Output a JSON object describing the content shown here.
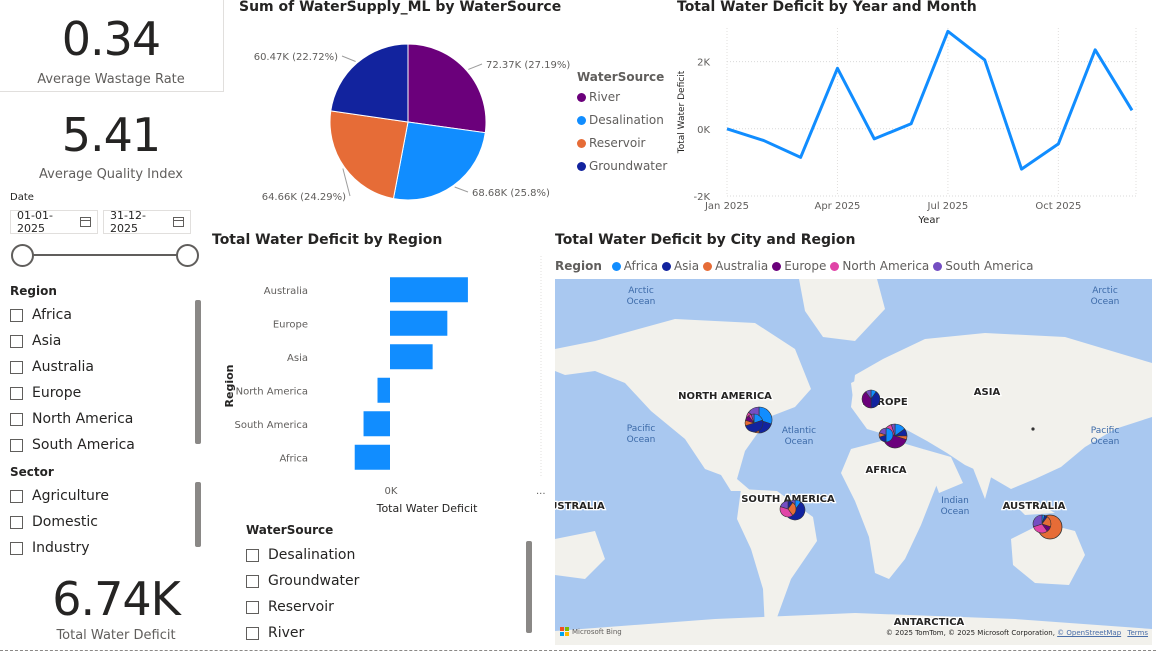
{
  "kpi": {
    "wastage_value": "0.34",
    "wastage_label": "Average Wastage Rate",
    "quality_value": "5.41",
    "quality_label": "Average Quality Index",
    "deficit_value": "6.74K",
    "deficit_label": "Total Water Deficit"
  },
  "date_slicer": {
    "title": "Date",
    "start": "01-01-2025",
    "end": "31-12-2025"
  },
  "region_slicer": {
    "title": "Region",
    "items": [
      "Africa",
      "Asia",
      "Australia",
      "Europe",
      "North America",
      "South America"
    ]
  },
  "sector_slicer": {
    "title": "Sector",
    "items": [
      "Agriculture",
      "Domestic",
      "Industry"
    ]
  },
  "source_slicer": {
    "title": "WaterSource",
    "items": [
      "Desalination",
      "Groundwater",
      "Reservoir",
      "River"
    ]
  },
  "pie": {
    "title": "Sum of WaterSupply_ML by WaterSource",
    "legend_title": "WaterSource",
    "slices": [
      {
        "name": "River",
        "value": 72.37,
        "label": "72.37K (27.19%)",
        "color": "#6b007b"
      },
      {
        "name": "Desalination",
        "value": 68.68,
        "label": "68.68K (25.8%)",
        "color": "#118dff"
      },
      {
        "name": "Reservoir",
        "value": 64.66,
        "label": "64.66K (24.29%)",
        "color": "#e66c37"
      },
      {
        "name": "Groundwater",
        "value": 60.47,
        "label": "60.47K (22.72%)",
        "color": "#12239e"
      }
    ]
  },
  "line": {
    "title": "Total Water Deficit by Year and Month",
    "ylabel": "Total Water Deficit",
    "xlabel": "Year",
    "yticks": [
      "2K",
      "0K",
      "-2K"
    ],
    "xticks": [
      "Jan 2025",
      "Apr 2025",
      "Jul 2025",
      "Oct 2025"
    ],
    "color": "#118dff"
  },
  "bar": {
    "title": "Total Water Deficit by Region",
    "ylabel": "Region",
    "xlabel": "Total Water Deficit",
    "xtick": "0K",
    "more": "...",
    "color": "#118dff"
  },
  "map": {
    "title": "Total Water Deficit by City and Region",
    "legend_title": "Region",
    "legend": [
      {
        "name": "Africa",
        "color": "#118dff"
      },
      {
        "name": "Asia",
        "color": "#12239e"
      },
      {
        "name": "Australia",
        "color": "#e66c37"
      },
      {
        "name": "Europe",
        "color": "#6b007b"
      },
      {
        "name": "North America",
        "color": "#e044a7"
      },
      {
        "name": "South America",
        "color": "#744ec2"
      }
    ],
    "labels": {
      "arctic_left": "Arctic\nOcean",
      "arctic_right": "Arctic\nOcean",
      "north_america": "NORTH AMERICA",
      "europe": "EUROPE",
      "asia": "ASIA",
      "pacific_left": "Pacific\nOcean",
      "atlantic": "Atlantic\nOcean",
      "pacific_right": "Pacific\nOcean",
      "africa": "AFRICA",
      "south_america": "SOUTH AMERICA",
      "australia_left": "USTRALIA",
      "indian": "Indian\nOcean",
      "australia": "AUSTRALIA",
      "antarctica": "ANTARCTICA"
    },
    "bing": "Microsoft Bing",
    "attribution": "© 2025 TomTom, © 2025 Microsoft Corporation,",
    "osm": "© OpenStreetMap",
    "terms": "Terms"
  },
  "chart_data": [
    {
      "type": "pie",
      "title": "Sum of WaterSupply_ML by WaterSource",
      "categories": [
        "River",
        "Desalination",
        "Reservoir",
        "Groundwater"
      ],
      "values": [
        72.37,
        68.68,
        64.66,
        60.47
      ],
      "unit": "K",
      "legend": "right"
    },
    {
      "type": "line",
      "title": "Total Water Deficit by Year and Month",
      "xlabel": "Year",
      "ylabel": "Total Water Deficit",
      "x": [
        "2025-01",
        "2025-02",
        "2025-03",
        "2025-04",
        "2025-05",
        "2025-06",
        "2025-07",
        "2025-08",
        "2025-09",
        "2025-10",
        "2025-11",
        "2025-12"
      ],
      "values": [
        0,
        -350,
        -850,
        1800,
        -300,
        150,
        2900,
        2050,
        -1200,
        -450,
        2350,
        550
      ],
      "ylim": [
        -2000,
        3000
      ],
      "grid": true
    },
    {
      "type": "bar",
      "orientation": "horizontal",
      "title": "Total Water Deficit by Region",
      "xlabel": "Total Water Deficit",
      "ylabel": "Region",
      "categories": [
        "Australia",
        "Europe",
        "Asia",
        "North America",
        "South America",
        "Africa"
      ],
      "values": [
        5300,
        3900,
        2900,
        -850,
        -1800,
        -2400
      ]
    }
  ]
}
